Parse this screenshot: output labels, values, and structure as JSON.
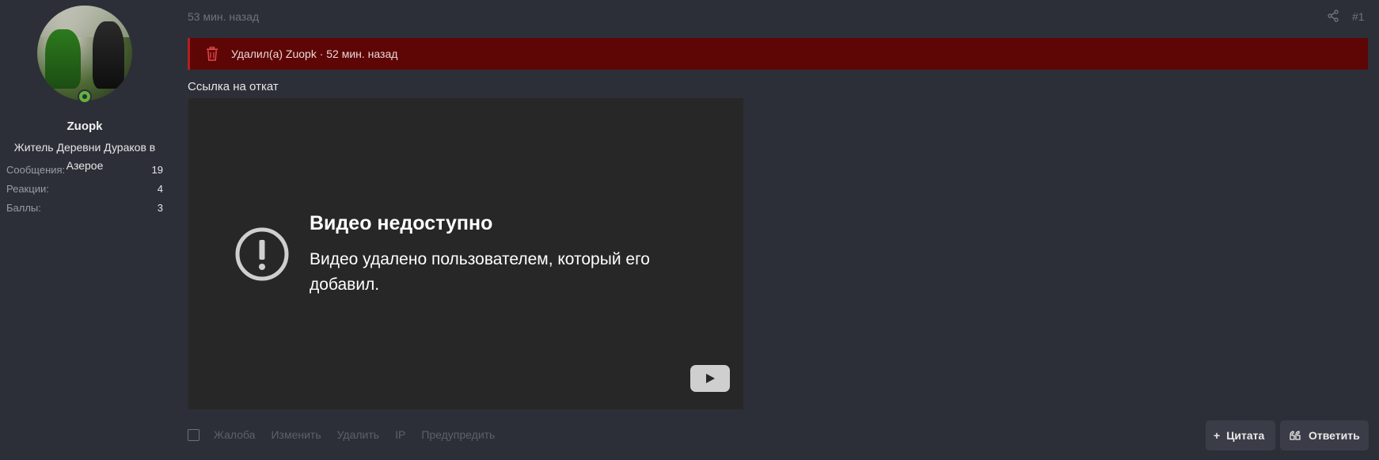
{
  "user": {
    "name": "Zuopk",
    "title": "Житель Деревни Дураков в Азерое",
    "stats": [
      {
        "label": "Сообщения:",
        "value": "19"
      },
      {
        "label": "Реакции:",
        "value": "4"
      },
      {
        "label": "Баллы:",
        "value": "3"
      }
    ]
  },
  "post": {
    "time": "53 мин. назад",
    "number": "#1",
    "deleted_notice": "Удалил(а) Zuopk · 52 мин. назад",
    "message": "Ссылка на откат"
  },
  "video": {
    "title": "Видео недоступно",
    "message": "Видео удалено пользователем, который его добавил."
  },
  "actions": {
    "report": "Жалоба",
    "edit": "Изменить",
    "delete": "Удалить",
    "ip": "IP",
    "warn": "Предупредить"
  },
  "buttons": {
    "quote": "Цитата",
    "reply": "Ответить"
  },
  "colors": {
    "background": "#2d2f38",
    "deleted_bar": "#5e0606",
    "online": "#63b23f"
  }
}
